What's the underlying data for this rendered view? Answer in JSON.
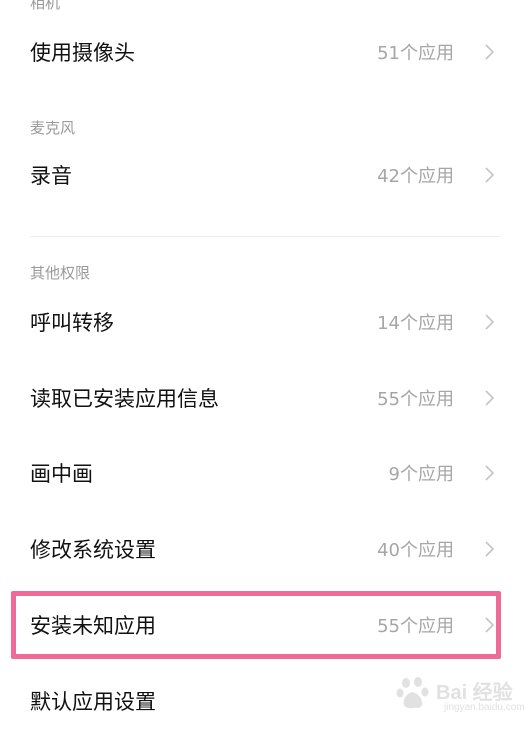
{
  "sections": {
    "camera": "相机",
    "microphone": "麦克风",
    "other": "其他权限"
  },
  "rows": [
    {
      "label": "使用摄像头",
      "count": "51个应用"
    },
    {
      "label": "录音",
      "count": "42个应用"
    },
    {
      "label": "呼叫转移",
      "count": "14个应用"
    },
    {
      "label": "读取已安装应用信息",
      "count": "55个应用"
    },
    {
      "label": "画中画",
      "count": "9个应用"
    },
    {
      "label": "修改系统设置",
      "count": "40个应用"
    },
    {
      "label": "安装未知应用",
      "count": "55个应用"
    },
    {
      "label": "默认应用设置",
      "count": ""
    }
  ],
  "watermark": {
    "brand": "Bai 经验",
    "url": "jingyan.baidu.com"
  },
  "colors": {
    "highlight_border": "#ef6a98",
    "secondary_text": "#a6a6a6",
    "section_label": "#9a9a9a"
  },
  "icons": {
    "chevron": "chevron-right-icon",
    "paw": "baidu-paw-icon"
  }
}
